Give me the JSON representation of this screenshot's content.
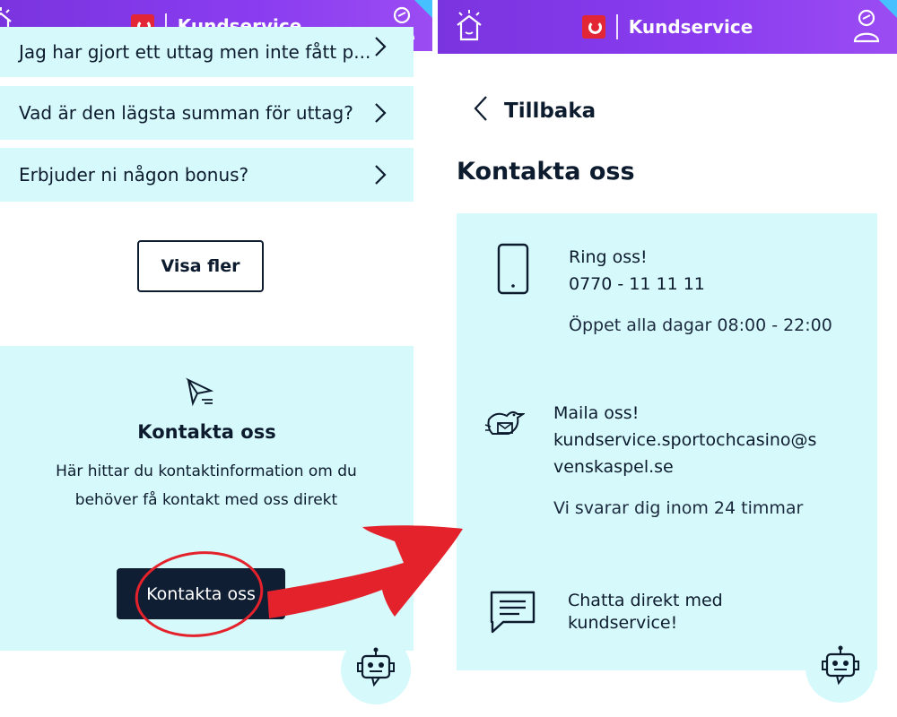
{
  "header": {
    "title": "Kundservice"
  },
  "left": {
    "faq_items": [
      {
        "label": "Jag har gjort ett uttag men inte fått p..."
      },
      {
        "label": "Vad är den lägsta summan för uttag?"
      },
      {
        "label": "Erbjuder ni någon bonus?"
      }
    ],
    "show_more_label": "Visa fler",
    "contact": {
      "title": "Kontakta oss",
      "description_line1": "Här hittar du kontaktinformation om du",
      "description_line2": "behöver få kontakt med oss direkt",
      "button_label": "Kontakta oss"
    }
  },
  "right": {
    "back_label": "Tillbaka",
    "page_title": "Kontakta oss",
    "phone": {
      "heading": "Ring oss!",
      "number": "0770 - 11 11 11",
      "hours": "Öppet alla dagar 08:00 - 22:00"
    },
    "email": {
      "heading": "Maila oss!",
      "address_line1": "kundservice.sportochcasino@s",
      "address_line2": "venskaspel.se",
      "response": "Vi svarar dig inom 24 timmar"
    },
    "chat": {
      "line1": "Chatta direkt med",
      "line2": "kundservice!"
    }
  },
  "colors": {
    "header_gradient_start": "#7a34df",
    "card_background": "#d6f9fb",
    "dark_button": "#0f1e33",
    "annotation_red": "#e4222c",
    "corner_accent": "#46c0ff"
  },
  "icons": [
    "home-icon",
    "user-icon",
    "chevron-right-icon",
    "paper-plane-icon",
    "phone-icon",
    "bird-mail-icon",
    "chat-icon",
    "robot-icon",
    "chevron-left-icon"
  ]
}
